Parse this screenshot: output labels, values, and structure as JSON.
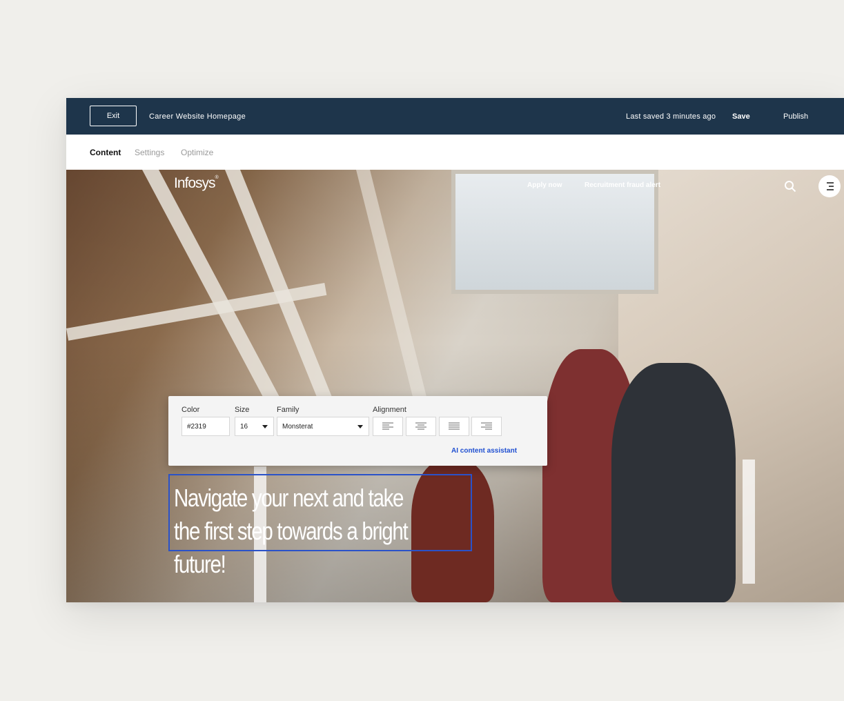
{
  "editor": {
    "exit_label": "Exit",
    "document_title": "Career Website Homepage",
    "last_saved": "Last saved 3 minutes ago",
    "save_label": "Save",
    "publish_label": "Publish",
    "tabs": [
      {
        "label": "Content",
        "active": true
      },
      {
        "label": "Settings",
        "active": false
      },
      {
        "label": "Optimize",
        "active": false
      }
    ],
    "colors": {
      "topbar": "#1e354b",
      "accent": "#2a52c9",
      "link": "#1f4fd1"
    }
  },
  "site": {
    "logo_text": "Infosys",
    "logo_mark": "®",
    "nav": [
      {
        "label": "Apply now"
      },
      {
        "label": "Recruitment fraud alert"
      }
    ],
    "icons": [
      "search-icon",
      "menu-icon"
    ],
    "headline": "Navigate your next and take the first step towards a bright future!"
  },
  "text_toolbar": {
    "color_label": "Color",
    "color_value": "#2319",
    "size_label": "Size",
    "size_value": "16",
    "family_label": "Family",
    "family_value": "Monsterat",
    "alignment_label": "Alignment",
    "alignment_options": [
      "align-left-icon",
      "align-center-icon",
      "align-justify-icon",
      "align-right-icon"
    ],
    "ai_link_label": "AI content assistant"
  }
}
